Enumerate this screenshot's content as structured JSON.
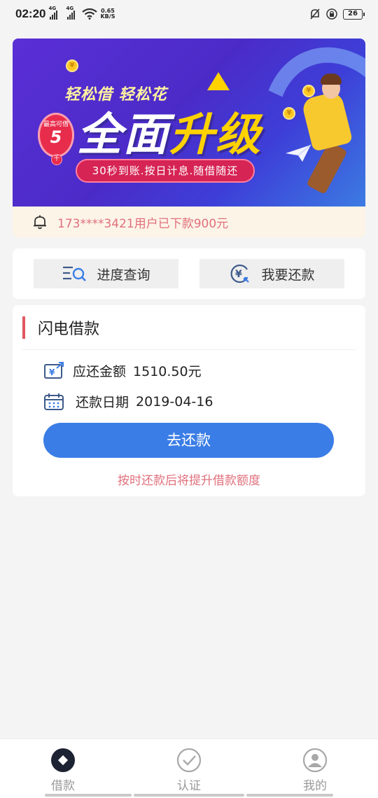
{
  "status_bar": {
    "time": "02:20",
    "sim1": "4G",
    "sim2": "4G",
    "speed_value": "0.65",
    "speed_unit": "KB/S",
    "battery": "26"
  },
  "banner": {
    "line1": "轻松借 轻松花",
    "line2_a": "全面",
    "line2_b": "升级",
    "badge_label": "最高可借",
    "badge_number": "5",
    "badge_unit": "千",
    "pill_text": "30秒到账.按日计息.随借随还",
    "coin_symbol": "¥"
  },
  "notice": {
    "text": "173****3421用户已下款900元",
    "icon": "bell-icon"
  },
  "quick_actions": {
    "progress_label": "进度查询",
    "progress_icon": "search-list-icon",
    "repay_label": "我要还款",
    "repay_icon": "yuan-refresh-icon"
  },
  "loan": {
    "title": "闪电借款",
    "amount_label": "应还金额",
    "amount_value": "1510.50元",
    "date_label": "还款日期",
    "date_value": "2019-04-16",
    "button_label": "去还款",
    "hint": "按时还款后将提升借款额度"
  },
  "bottom_nav": [
    {
      "label": "借款",
      "icon": "diamond-icon",
      "active": true
    },
    {
      "label": "认证",
      "icon": "check-circle-icon",
      "active": false
    },
    {
      "label": "我的",
      "icon": "user-icon",
      "active": false
    }
  ],
  "colors": {
    "accent_blue": "#3a7de6",
    "hint_red": "#e0707c",
    "title_bar_red": "#e0585f",
    "notice_bg": "#fdf4e8"
  }
}
